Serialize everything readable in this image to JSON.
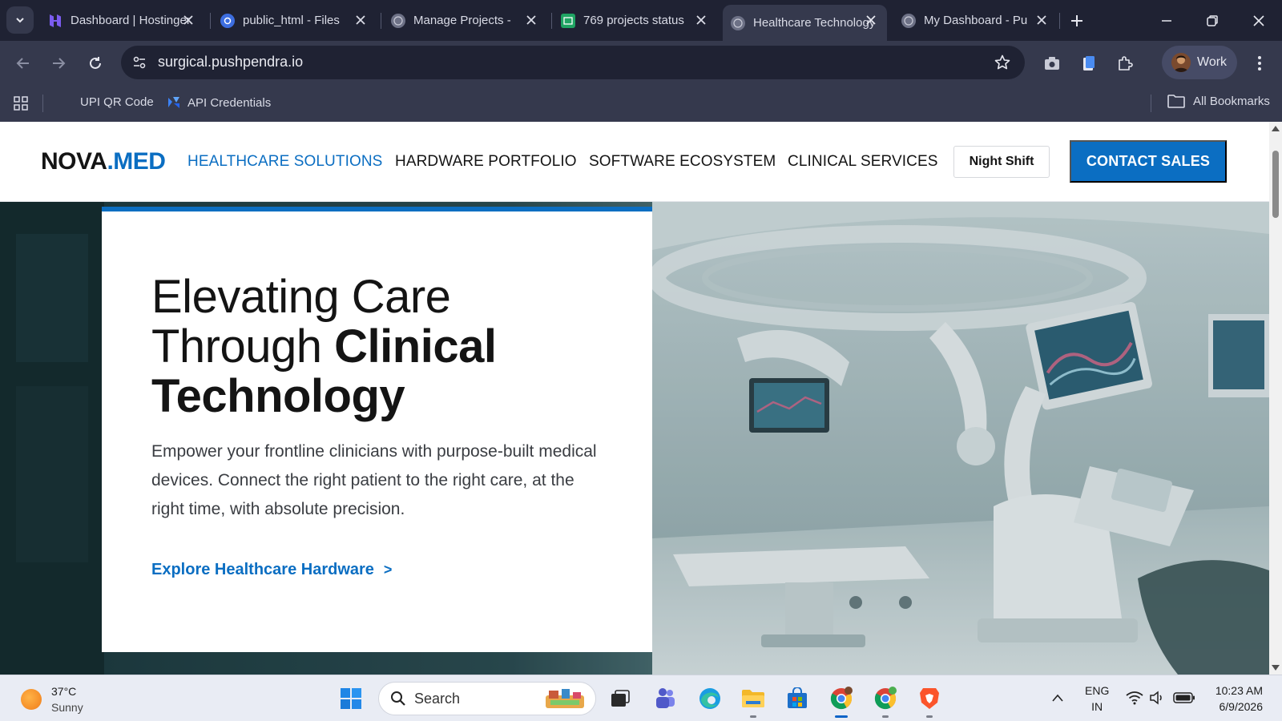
{
  "browser": {
    "tabs": [
      {
        "title": "Dashboard | Hostinger",
        "active": false
      },
      {
        "title": "public_html - Files",
        "active": false
      },
      {
        "title": "Manage Projects - ",
        "active": false
      },
      {
        "title": "769 projects status",
        "active": false
      },
      {
        "title": "Healthcare Technology",
        "active": true
      },
      {
        "title": "My Dashboard - Pu",
        "active": false
      }
    ],
    "url": "surgical.pushpendra.io",
    "profile_label": "Work",
    "bookmarks": [
      {
        "label": "UPI QR Code"
      },
      {
        "label": "API Credentials"
      }
    ],
    "all_bookmarks_label": "All Bookmarks"
  },
  "site": {
    "logo_main": "NOVA",
    "logo_accent": ".MED",
    "nav": [
      {
        "label": "HEALTHCARE SOLUTIONS",
        "active": true
      },
      {
        "label": "HARDWARE PORTFOLIO",
        "active": false
      },
      {
        "label": "SOFTWARE ECOSYSTEM",
        "active": false
      },
      {
        "label": "CLINICAL SERVICES",
        "active": false
      }
    ],
    "night_shift_label": "Night Shift",
    "contact_label": "CONTACT SALES",
    "accent_color": "#0b6ec2"
  },
  "hero": {
    "title_line1": "Elevating Care",
    "title_line2_light": "Through ",
    "title_line2_bold": "Clinical",
    "title_line3": "Technology",
    "description": "Empower your frontline clinicians with purpose-built medical devices. Connect the right patient to the right care, at the right time, with absolute precision.",
    "cta_label": "Explore Healthcare Hardware",
    "cta_chevron": ">"
  },
  "taskbar": {
    "weather_temp": "37°C",
    "weather_condition": "Sunny",
    "search_placeholder": "Search",
    "language_line1": "ENG",
    "language_line2": "IN",
    "time": "10:23 AM",
    "date": "6/9/2026"
  }
}
